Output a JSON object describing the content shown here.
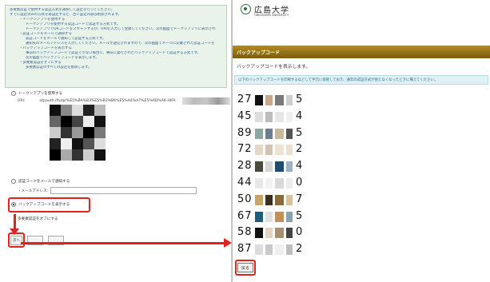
{
  "left_screen": {
    "info_lines": [
      {
        "text": "多要素認証で使用する認証方式を選択して設定を行ってください。",
        "level": 0
      },
      {
        "text": "すでに設定済みの方式を再設定すると、古い設定内容は削除されます。",
        "level": 0
      },
      {
        "text": "・トークンアプリを使用する",
        "level": 1
      },
      {
        "text": "トークンアプリを使用する認証コードで認証する方式です。",
        "level": 2
      },
      {
        "text": "トークンアプリでQRコードをスキャンするか、URIを入力して登録してください。次の画面でトークンアプリに表示され",
        "level": 2
      },
      {
        "text": "・認証コードをメールで通知する",
        "level": 1
      },
      {
        "text": "認証コードをメールで通知して認証する方式です。",
        "level": 2
      },
      {
        "text": "通知先のメールアドレスを入力してください。メールが送信されますので、次の画面でメールに記載された認証コードを",
        "level": 2
      },
      {
        "text": "・バックアップコードを表示する",
        "level": 1
      },
      {
        "text": "事前のバックアップコードで認証できない場合に、事前に発行されたバックアップコードで認証する方式です。",
        "level": 2
      },
      {
        "text": "次の画面でバックアップコードを表示します。",
        "level": 2
      },
      {
        "text": "・多要素認証をオフにする",
        "level": 1
      },
      {
        "text": "多要素認証のすべての設定を削除します。",
        "level": 2
      }
    ],
    "option_token": "トークンアプリを使用する",
    "uri_label": "URI:",
    "uri_value": "otpauth://totp/%E5%BA%83%E5%B3%B6%E5%A4%A7%E5%AD%A6-HIFA",
    "option_email": "認証コードをメールで通知する",
    "email_label": "・メールアドレス:",
    "option_backup": "バックアップコードを表示する",
    "option_off": "多要素認証をオフにする",
    "next_button": "次へ",
    "btn2": "",
    "btn3": ""
  },
  "right_screen": {
    "logo_jp": "広島大学",
    "logo_en": "HIROSHIMA UNIVERSITY",
    "title": "バックアップコード",
    "subtitle": "バックアップコードを表示します。",
    "notice": "以下のバックアップコードを印刷するなどして手元に保管しておき、通常の認証方式が使えなくなったときに備えてください。",
    "codes": [
      {
        "prefix": "27",
        "suffix": "5"
      },
      {
        "prefix": "45",
        "suffix": "4"
      },
      {
        "prefix": "89",
        "suffix": "5"
      },
      {
        "prefix": "72",
        "suffix": "2"
      },
      {
        "prefix": "28",
        "suffix": "4"
      },
      {
        "prefix": "44",
        "suffix": "0"
      },
      {
        "prefix": "50",
        "suffix": "7"
      },
      {
        "prefix": "67",
        "suffix": "5"
      },
      {
        "prefix": "58",
        "suffix": "0"
      },
      {
        "prefix": "87",
        "suffix": "2"
      }
    ],
    "back_button": "戻る"
  },
  "colors": {
    "highlight_red": "#e0231b",
    "title_gold": "#9a7416",
    "info_green_bg": "#eaf3ea",
    "notice_blue_bg": "#dff0f7"
  }
}
